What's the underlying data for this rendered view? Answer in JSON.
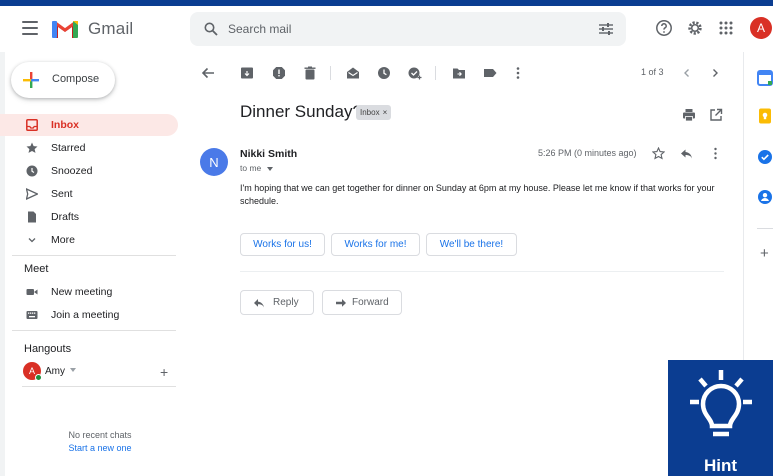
{
  "app": {
    "name": "Gmail",
    "account_initial": "A"
  },
  "search": {
    "placeholder": "Search mail"
  },
  "sidebar": {
    "compose_label": "Compose",
    "items": [
      {
        "label": "Inbox",
        "icon": "inbox-icon",
        "active": true
      },
      {
        "label": "Starred",
        "icon": "star-icon"
      },
      {
        "label": "Snoozed",
        "icon": "clock-icon"
      },
      {
        "label": "Sent",
        "icon": "send-icon"
      },
      {
        "label": "Drafts",
        "icon": "draft-icon"
      },
      {
        "label": "More",
        "icon": "chevron-down-icon"
      }
    ],
    "meet": {
      "title": "Meet",
      "items": [
        {
          "label": "New meeting",
          "icon": "video-icon"
        },
        {
          "label": "Join a meeting",
          "icon": "keyboard-icon"
        }
      ]
    },
    "hangouts": {
      "title": "Hangouts",
      "user_initial": "A",
      "user_name": "Amy",
      "no_chats": "No recent chats",
      "start_new": "Start a new one"
    }
  },
  "toolbar": {
    "pager": "1 of 3"
  },
  "message": {
    "subject": "Dinner Sunday?",
    "label": "Inbox",
    "label_close": "×",
    "sender_initial": "N",
    "sender_name": "Nikki Smith",
    "recipient": "to me",
    "timestamp": "5:26 PM (0 minutes ago)",
    "body": "I'm hoping that we can get together for dinner on Sunday at 6pm at my house. Please let me know if that works for your schedule.",
    "smart_replies": [
      "Works for us!",
      "Works for me!",
      "We'll be there!"
    ],
    "reply_label": "Reply",
    "forward_label": "Forward"
  },
  "hint": {
    "label": "Hint"
  },
  "colors": {
    "accent_blue": "#1a73e8",
    "active_red": "#d93025",
    "active_bg": "#fce8e6",
    "hint_bg": "#0b3d91"
  }
}
